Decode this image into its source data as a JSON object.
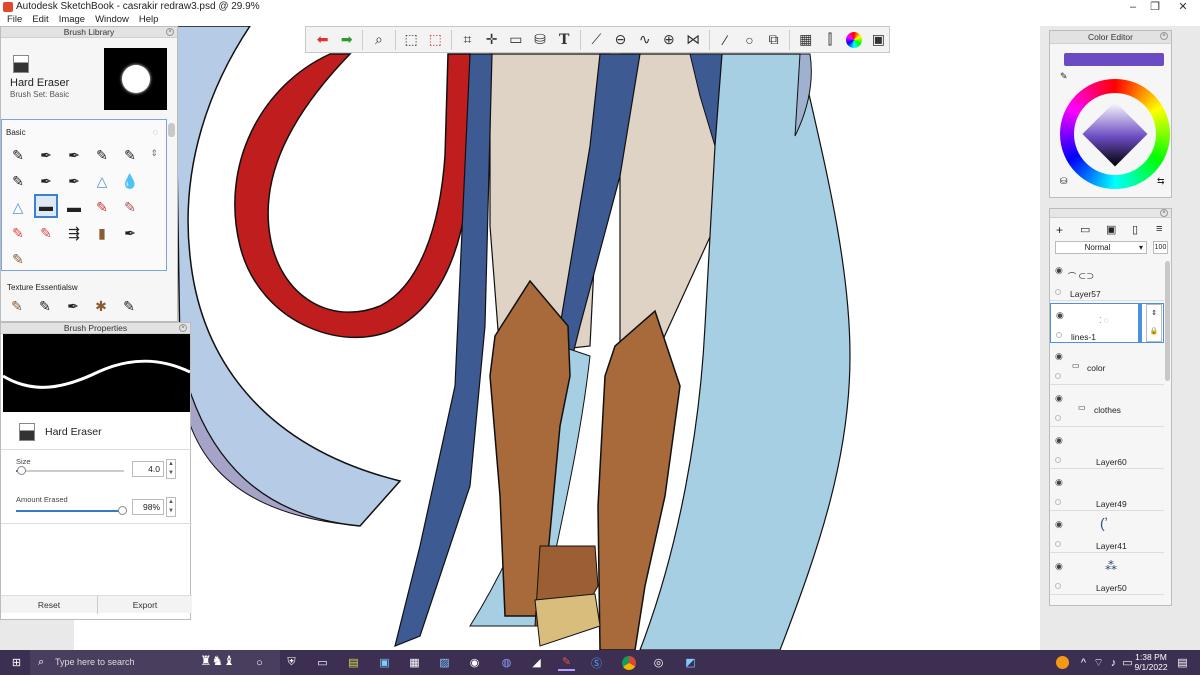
{
  "window": {
    "title": "Autodesk SketchBook - casrakir redraw3.psd @ 29.9%",
    "controls": [
      "–",
      "❐",
      "✕"
    ]
  },
  "menu": [
    "File",
    "Edit",
    "Image",
    "Window",
    "Help"
  ],
  "toolbar": {
    "tools": [
      "undo-icon",
      "redo-icon",
      "magnifier-icon",
      "select-icon",
      "lasso-icon",
      "crop-icon",
      "transform-icon",
      "distort-icon",
      "fill-icon",
      "text-icon",
      "ruler-icon",
      "ellipse-guide-icon",
      "curve-icon",
      "perspective-icon",
      "symmetry-icon",
      "stroke-icon",
      "circle-icon",
      "shape-icon",
      "copic-icon",
      "brushes-icon",
      "color-wheel-icon",
      "palette-icon"
    ]
  },
  "brush_library": {
    "title": "Brush Library",
    "current_brush": "Hard Eraser",
    "brush_set": "Brush Set: Basic",
    "section_basic": "Basic",
    "section_texture": "Texture Essentialsw"
  },
  "brush_properties": {
    "title": "Brush Properties",
    "brush_name": "Hard Eraser",
    "size_label": "Size",
    "size_value": "4.0",
    "size_fraction": 0.05,
    "amount_label": "Amount Erased",
    "amount_value": "98%",
    "amount_fraction": 0.98,
    "reset_label": "Reset",
    "export_label": "Export"
  },
  "color_editor": {
    "title": "Color Editor",
    "current_color": "#6a4bc2"
  },
  "layers": {
    "blend_mode": "Normal",
    "opacity": "100",
    "items": [
      {
        "name": "Layer57"
      },
      {
        "name": "lines-1"
      },
      {
        "name": "color"
      },
      {
        "name": "clothes"
      },
      {
        "name": "Layer60"
      },
      {
        "name": "Layer49"
      },
      {
        "name": "Layer41"
      },
      {
        "name": "Layer50"
      }
    ]
  },
  "taskbar": {
    "search_placeholder": "Type here to search",
    "time": "1:38 PM",
    "date": "9/1/2022"
  },
  "colors": {
    "taskbar": "#3c2f52",
    "tail_red": "#c01e1e",
    "skirt_blue": "#3d5a92",
    "drape_lightblue": "#a7cfe3",
    "skin": "#a8693b",
    "beige": "#ded3c4",
    "lavender": "#a5a3c7"
  }
}
